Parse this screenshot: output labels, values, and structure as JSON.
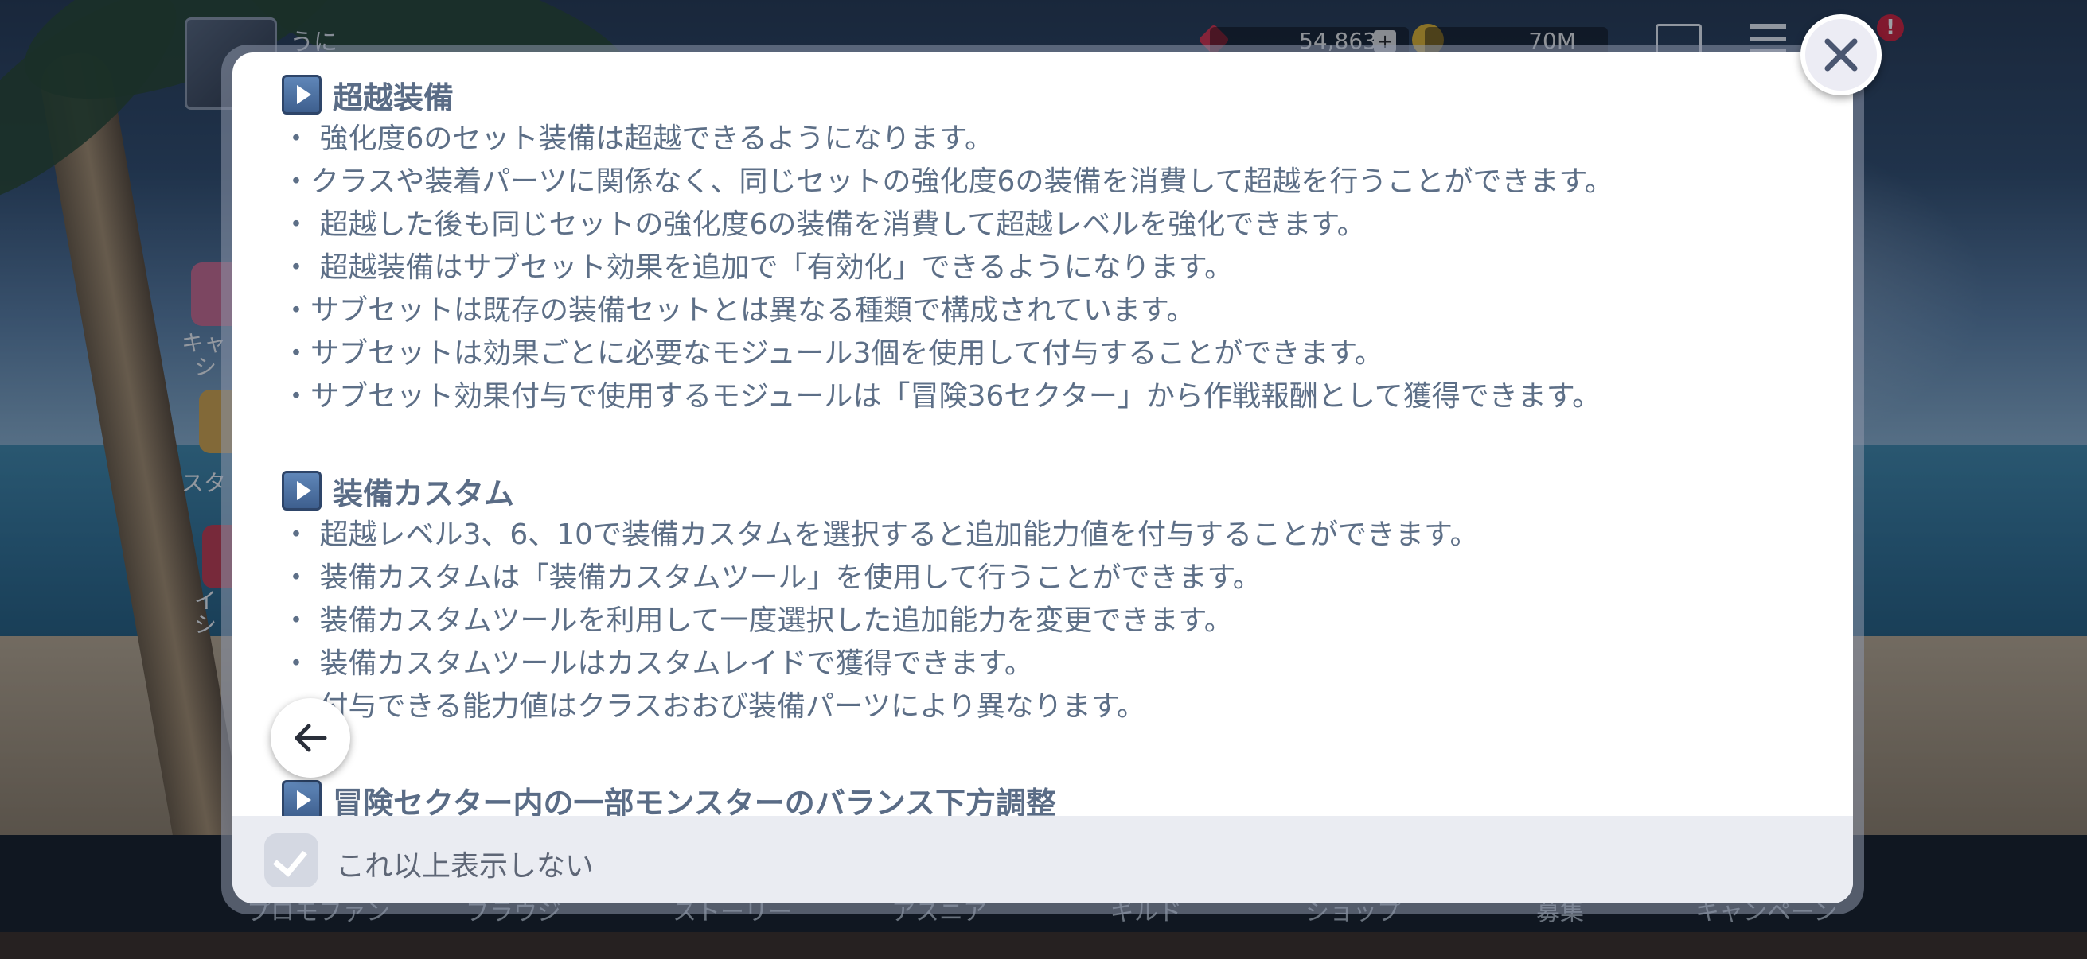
{
  "background": {
    "player_name": "うに",
    "gems": "54,863",
    "gold": "70M",
    "side_labels": [
      "キャ",
      "シ",
      "スタ",
      "イ",
      "シ"
    ],
    "bottom_nav": [
      "プロモファン",
      "ブラウジ",
      "ストーリー",
      "アスニア",
      "ギルド",
      "ショップ",
      "募集",
      "キャンペーン"
    ]
  },
  "modal": {
    "sections": [
      {
        "title": "超越装備",
        "lines": [
          "・ 強化度6のセット装備は超越できるようになります。",
          "・クラスや装着パーツに関係なく、同じセットの強化度6の装備を消費して超越を行うことができます。",
          "・ 超越した後も同じセットの強化度6の装備を消費して超越レベルを強化できます。",
          "・ 超越装備はサブセット効果を追加で「有効化」できるようになります。",
          "・サブセットは既存の装備セットとは異なる種類で構成されています。",
          "・サブセットは効果ごとに必要なモジュール3個を使用して付与することができます。",
          "・サブセット効果付与で使用するモジュールは「冒険36セクター」から作戦報酬として獲得できます。"
        ]
      },
      {
        "title": "装備カスタム",
        "lines": [
          "・ 超越レベル3、6、10で装備カスタムを選択すると追加能力値を付与することができます。",
          "・ 装備カスタムは「装備カスタムツール」を使用して行うことができます。",
          "・ 装備カスタムツールを利用して一度選択した追加能力を変更できます。",
          "・ 装備カスタムツールはカスタムレイドで獲得できます。",
          "・ 付与できる能力値はクラスおおび装備パーツにより異なります。"
        ]
      },
      {
        "title": "冒険セクター内の一部モンスターのバランス下方調整",
        "lines": []
      }
    ],
    "footer": {
      "checkbox_label": "これ以上表示しない",
      "checked": true
    }
  },
  "icons": {
    "close": "close-icon",
    "back": "arrow-left-icon",
    "section": "play-icon"
  }
}
